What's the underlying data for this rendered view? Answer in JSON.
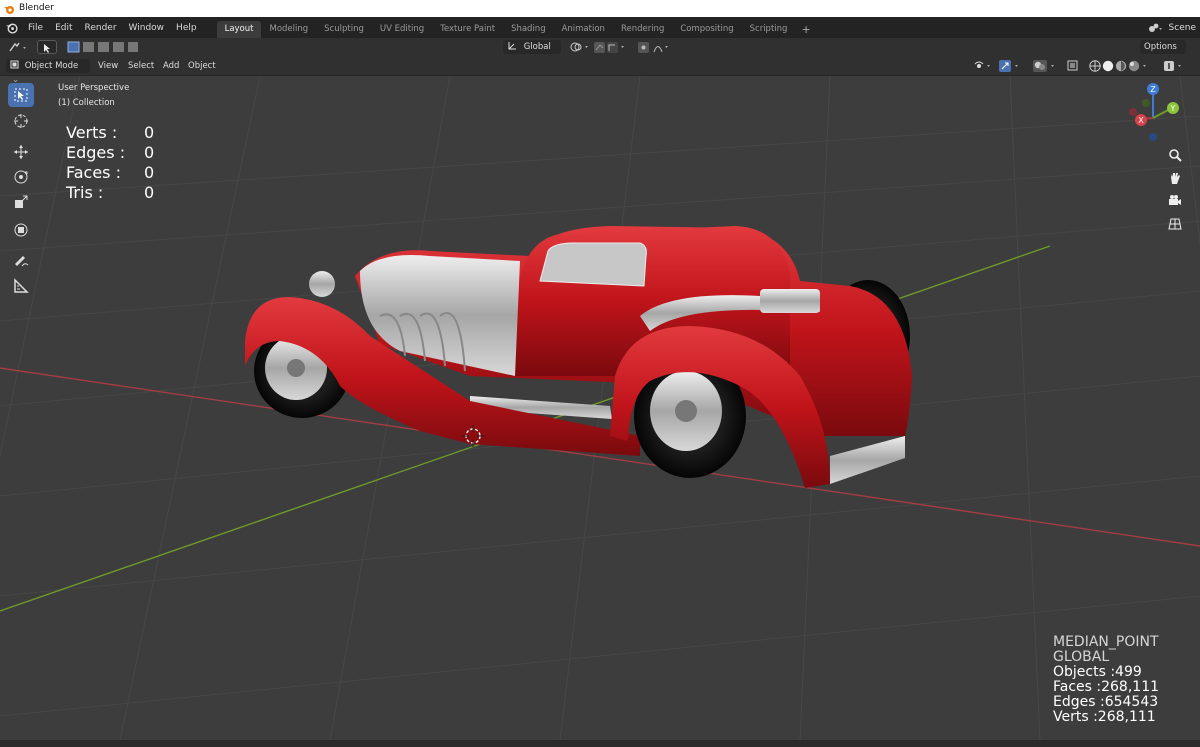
{
  "window": {
    "title": "Blender"
  },
  "menu": {
    "items": [
      "File",
      "Edit",
      "Render",
      "Window",
      "Help"
    ]
  },
  "workspaces": {
    "tabs": [
      "Layout",
      "Modeling",
      "Sculpting",
      "UV Editing",
      "Texture Paint",
      "Shading",
      "Animation",
      "Rendering",
      "Compositing",
      "Scripting"
    ],
    "active": "Layout",
    "add_label": "+"
  },
  "scene": {
    "label": "Scene"
  },
  "header": {
    "transform_orientation": "Global",
    "options_label": "Options",
    "mode_label": "Object Mode",
    "view_menu": [
      "View",
      "Select",
      "Add",
      "Object"
    ]
  },
  "viewport": {
    "perspective_label": "User Perspective",
    "collection_label": "(1) Collection",
    "stats": [
      {
        "label": "Verts :",
        "value": "0"
      },
      {
        "label": "Edges :",
        "value": "0"
      },
      {
        "label": "Faces :",
        "value": "0"
      },
      {
        "label": "Tris :",
        "value": "0"
      }
    ],
    "info": {
      "pivot": "MEDIAN_POINT",
      "orientation": "GLOBAL",
      "objects": "Objects :499",
      "faces": "Faces :268,111",
      "edges": "Edges :654543",
      "verts": "Verts :268,111"
    },
    "gizmo_axes": [
      "Z",
      "Y",
      "X"
    ]
  },
  "colors": {
    "active_tool": "#4a72b0",
    "car_body": "#c0141a",
    "x_axis": "#a33d43",
    "y_axis": "#6e9a2a",
    "z_axis": "#3e7ad6"
  }
}
